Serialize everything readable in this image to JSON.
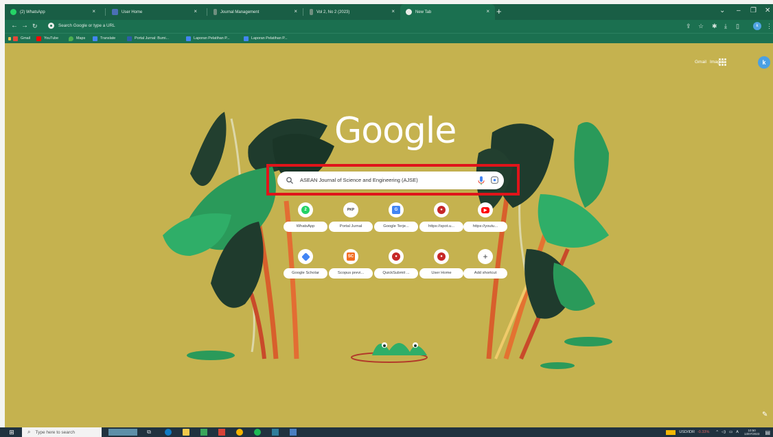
{
  "tabs": [
    {
      "title": "(2) WhatsApp",
      "color": "#25d366"
    },
    {
      "title": "User Home",
      "color": "#4a6fb5"
    },
    {
      "title": "Journal Management",
      "color": "#6f8f7f"
    },
    {
      "title": "Vol 2, No 2 (2023)",
      "color": "#6f8f7f"
    },
    {
      "title": "New Tab",
      "color": "#e8eee9"
    }
  ],
  "toolbar": {
    "omnibox_placeholder": "Search Google or type a URL"
  },
  "bookmarks": [
    {
      "label": "Gmail",
      "color": "#e5463a"
    },
    {
      "label": "YouTube",
      "color": "#ff0000"
    },
    {
      "label": "Maps",
      "color": "#4caf50"
    },
    {
      "label": "Translate",
      "color": "#4285f4"
    },
    {
      "label": "Portal Jurnal: Bumi...",
      "color": "#2c5ea8"
    },
    {
      "label": "Laporan Pelatihan P...",
      "color": "#4285f4"
    },
    {
      "label": "Laporan Pelatihan P...",
      "color": "#4285f4"
    }
  ],
  "ntp": {
    "gmail": "Gmail",
    "images": "Images",
    "avatar_letter": "k",
    "logo": "Google",
    "search_query": "ASEAN Journal of Science and Engineering (AJSE)",
    "shortcuts": [
      {
        "label": "WhatsApp",
        "icon": "whatsapp-icon",
        "glyph": "",
        "color": "#25d366"
      },
      {
        "label": "Portal Jurnal",
        "icon": "pkp-icon",
        "glyph": "PKP",
        "color": "#ffffff"
      },
      {
        "label": "Google Terje...",
        "icon": "translate-icon",
        "glyph": "G",
        "color": "#4285f4"
      },
      {
        "label": "https://spot.u...",
        "icon": "university-icon",
        "glyph": "",
        "color": "#c62828"
      },
      {
        "label": "https://youtu...",
        "icon": "youtube-icon",
        "glyph": "",
        "color": "#ff0000"
      },
      {
        "label": "Google Scholar",
        "icon": "scholar-icon",
        "glyph": "",
        "color": "#4285f4"
      },
      {
        "label": "Scopus previ...",
        "icon": "scopus-icon",
        "glyph": "SC",
        "color": "#f26c21"
      },
      {
        "label": "QuickSubmit ...",
        "icon": "quicksubmit-icon",
        "glyph": "",
        "color": "#c62828"
      },
      {
        "label": "User Home",
        "icon": "userhome-icon",
        "glyph": "",
        "color": "#c62828"
      },
      {
        "label": "Add shortcut",
        "icon": "plus-icon",
        "glyph": "+",
        "color": "#3c4043"
      }
    ]
  },
  "taskbar": {
    "search_placeholder": "Type here to search",
    "ticker": "USD/IDR",
    "ticker_change": "-0.33%",
    "time": "10:50",
    "date": "13/07/2023"
  }
}
